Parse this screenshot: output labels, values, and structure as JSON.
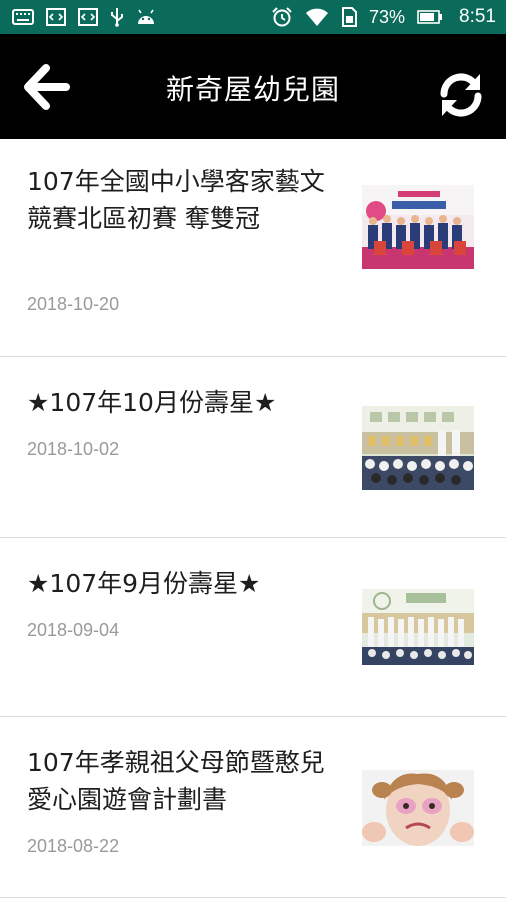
{
  "status_bar": {
    "battery": "73%",
    "time": "8:51",
    "icons": [
      "keyboard-icon",
      "code-icon",
      "code-icon",
      "usb-icon",
      "android-icon",
      "alarm-icon",
      "wifi-icon",
      "sim-icon",
      "battery-icon"
    ]
  },
  "app_bar": {
    "title": "新奇屋幼兒園",
    "back_icon": "back-arrow-icon",
    "refresh_icon": "refresh-icon"
  },
  "articles": [
    {
      "title": "107年全國中小學客家藝文競賽北區初賽 奪雙冠",
      "date": "2018-10-20",
      "thumbnail": "group-photo-stage"
    },
    {
      "title": "★107年10月份壽星★",
      "date": "2018-10-02",
      "thumbnail": "classroom-birthday-photo"
    },
    {
      "title": "★107年9月份壽星★",
      "date": "2018-09-04",
      "thumbnail": "classroom-birthday-photo"
    },
    {
      "title": "107年孝親祖父母節暨憨兒愛心園遊會計劃書",
      "date": "2018-08-22",
      "thumbnail": "child-face-paint-photo"
    }
  ],
  "colors": {
    "status_bar": "#0b6b5a",
    "app_bar": "#000000",
    "date_text": "#9a9a9a",
    "divider": "#dcdcdc"
  }
}
